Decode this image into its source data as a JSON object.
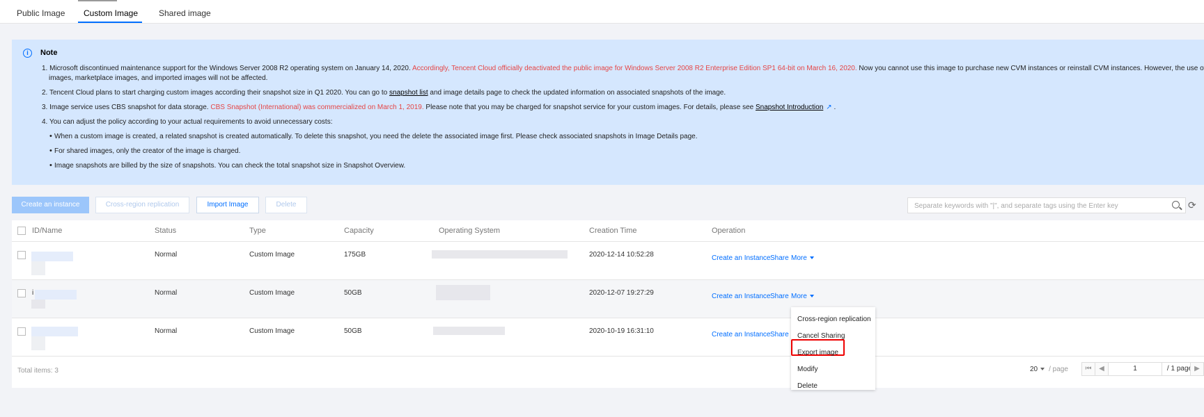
{
  "tabs": [
    "Public Image",
    "Custom Image",
    "Shared image"
  ],
  "active_tab": "Custom Image",
  "note": {
    "title": "Note",
    "line1_a": "1. Microsoft discontinued maintenance support for the Windows Server 2008 R2 operating system on January 14, 2020. ",
    "line1_red": "Accordingly, Tencent Cloud officially deactivated the public image for Windows Server 2008 R2 Enterprise Edition SP1 64-bit on March 16, 2020.",
    "line1_b": " Now you cannot use this image to purchase new CVM instances or reinstall CVM instances. However, the use of custom",
    "line1_c": "images, marketplace images, and imported images will not be affected.",
    "line2_a": "2. Tencent Cloud plans to start charging custom images according their snapshot size in Q1 2020. You can go to ",
    "line2_link": "snapshot list",
    "line2_b": " and image details page to check the updated information on associated snapshots of the image.",
    "line3_a": "3. Image service uses CBS snapshot for data storage. ",
    "line3_red": "CBS Snapshot (International) was commercialized on March 1, 2019.",
    "line3_b": " Please note that you may be charged for snapshot service for your custom images. For details, please see ",
    "line3_link": "Snapshot Introduction",
    "line3_c": " .",
    "line4": "4. You can adjust the policy according to your actual requirements to avoid unnecessary costs:",
    "bullets": [
      "When a custom image is created, a related snapshot is created automatically. To delete this snapshot, you need the delete the associated image first. Please check associated snapshots in Image Details page.",
      "For shared images, only the creator of the image is charged.",
      "Image snapshots are billed by the size of snapshots. You can check the total snapshot size in Snapshot Overview."
    ]
  },
  "toolbar": {
    "create": "Create an instance",
    "cross_region": "Cross-region replication",
    "import": "Import Image",
    "delete": "Delete",
    "search_placeholder": "Separate keywords with \"|\", and separate tags using the Enter key"
  },
  "table": {
    "headers": [
      "ID/Name",
      "Status",
      "Type",
      "Capacity",
      "Operating System",
      "Creation Time",
      "Operation"
    ],
    "rows": [
      {
        "id": "",
        "status": "Normal",
        "type": "Custom Image",
        "capacity": "175GB",
        "time": "2020-12-14 10:52:28"
      },
      {
        "id": "i",
        "status": "Normal",
        "type": "Custom Image",
        "capacity": "50GB",
        "time": "2020-12-07 19:27:29"
      },
      {
        "id": "",
        "status": "Normal",
        "type": "Custom Image",
        "capacity": "50GB",
        "time": "2020-10-19 16:31:10"
      }
    ],
    "ops": {
      "create": "Create an Instance",
      "share": "Share",
      "more": "More"
    },
    "total": "Total items: 3",
    "page_size": "20",
    "page_size_unit": "/ page",
    "page": "1",
    "page_total": "/ 1 page"
  },
  "dropdown": [
    "Cross-region replication",
    "Cancel Sharing",
    "Export image",
    "Modify",
    "Delete"
  ]
}
